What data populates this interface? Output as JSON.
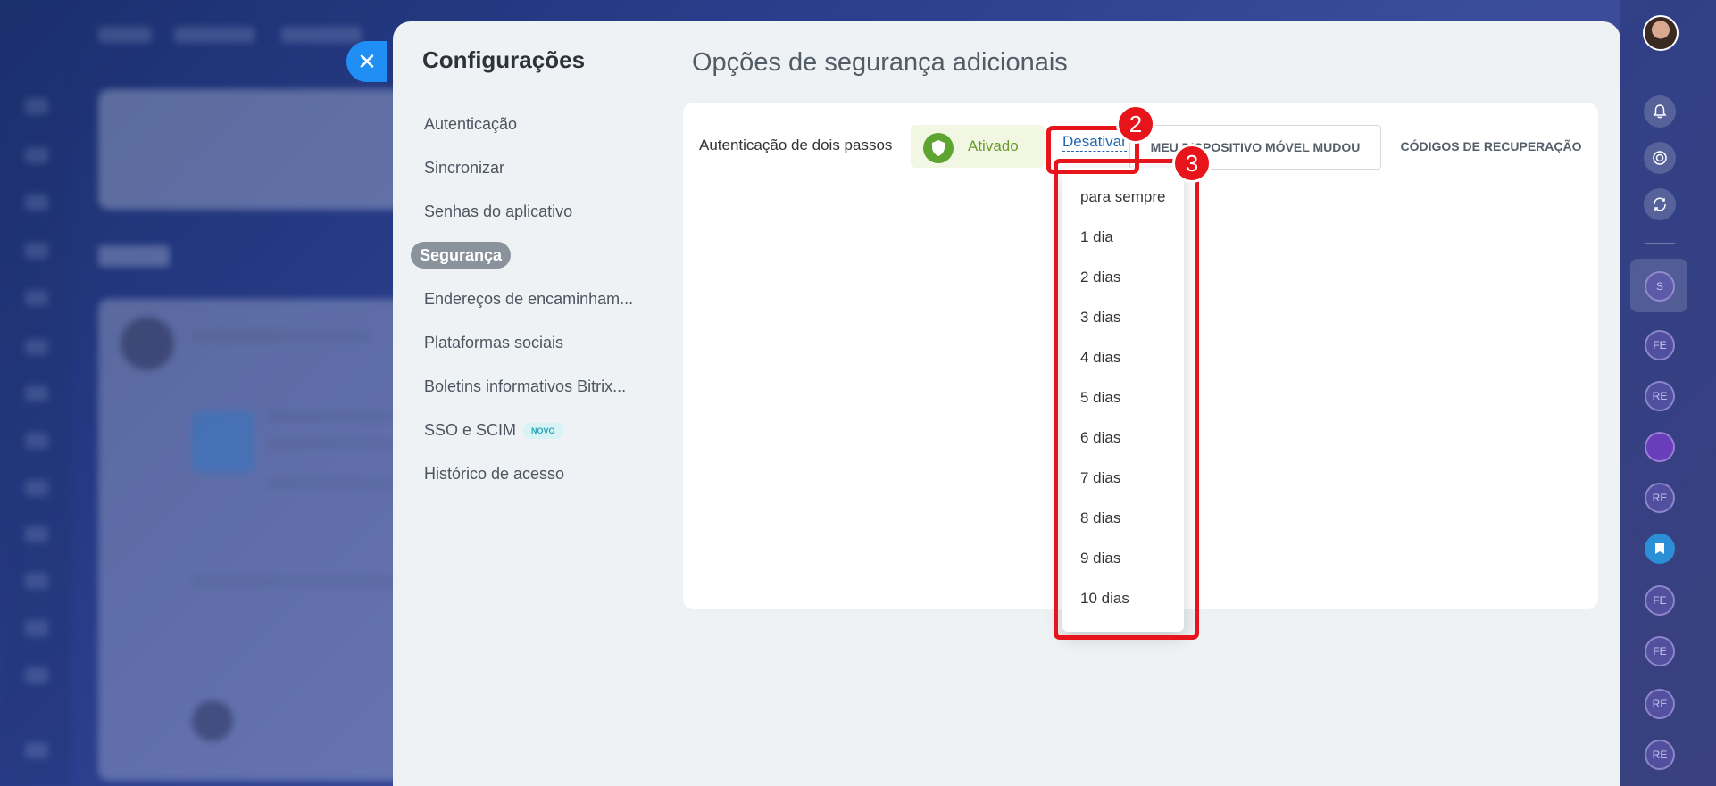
{
  "settings": {
    "title": "Configurações",
    "nav": [
      {
        "label": "Autenticação",
        "active": false
      },
      {
        "label": "Sincronizar",
        "active": false
      },
      {
        "label": "Senhas do aplicativo",
        "active": false
      },
      {
        "label": "Segurança",
        "active": true
      },
      {
        "label": "Endereços de encaminham...",
        "active": false
      },
      {
        "label": "Plataformas sociais",
        "active": false
      },
      {
        "label": "Boletins informativos Bitrix...",
        "active": false
      },
      {
        "label": "SSO e SCIM",
        "active": false,
        "badge": "NOVO"
      },
      {
        "label": "Histórico de acesso",
        "active": false
      }
    ]
  },
  "security": {
    "section_title": "Opções de segurança adicionais",
    "two_step": {
      "label": "Autenticação de dois passos",
      "status": "Ativado",
      "deactivate_link": "Desativar",
      "device_changed_button": "MEU DISPOSITIVO MÓVEL MUDOU",
      "recovery_codes_button": "CÓDIGOS DE RECUPERAÇÃO"
    },
    "deactivate_options": [
      "para sempre",
      "1 dia",
      "2 dias",
      "3 dias",
      "4 dias",
      "5 dias",
      "6 dias",
      "7 dias",
      "8 dias",
      "9 dias",
      "10 dias"
    ]
  },
  "annotations": [
    {
      "number": "2"
    },
    {
      "number": "3"
    }
  ],
  "right_bar": {
    "icons": [
      "bell-icon",
      "target-icon",
      "sync-icon"
    ],
    "avatars": [
      "S",
      "FE",
      "RE",
      "",
      "RE",
      "",
      "FE",
      "FE",
      "RE",
      "RE"
    ]
  },
  "colors": {
    "accent": "#1f8ff5",
    "annotation": "#e8141b",
    "status_green": "#5ea431"
  }
}
